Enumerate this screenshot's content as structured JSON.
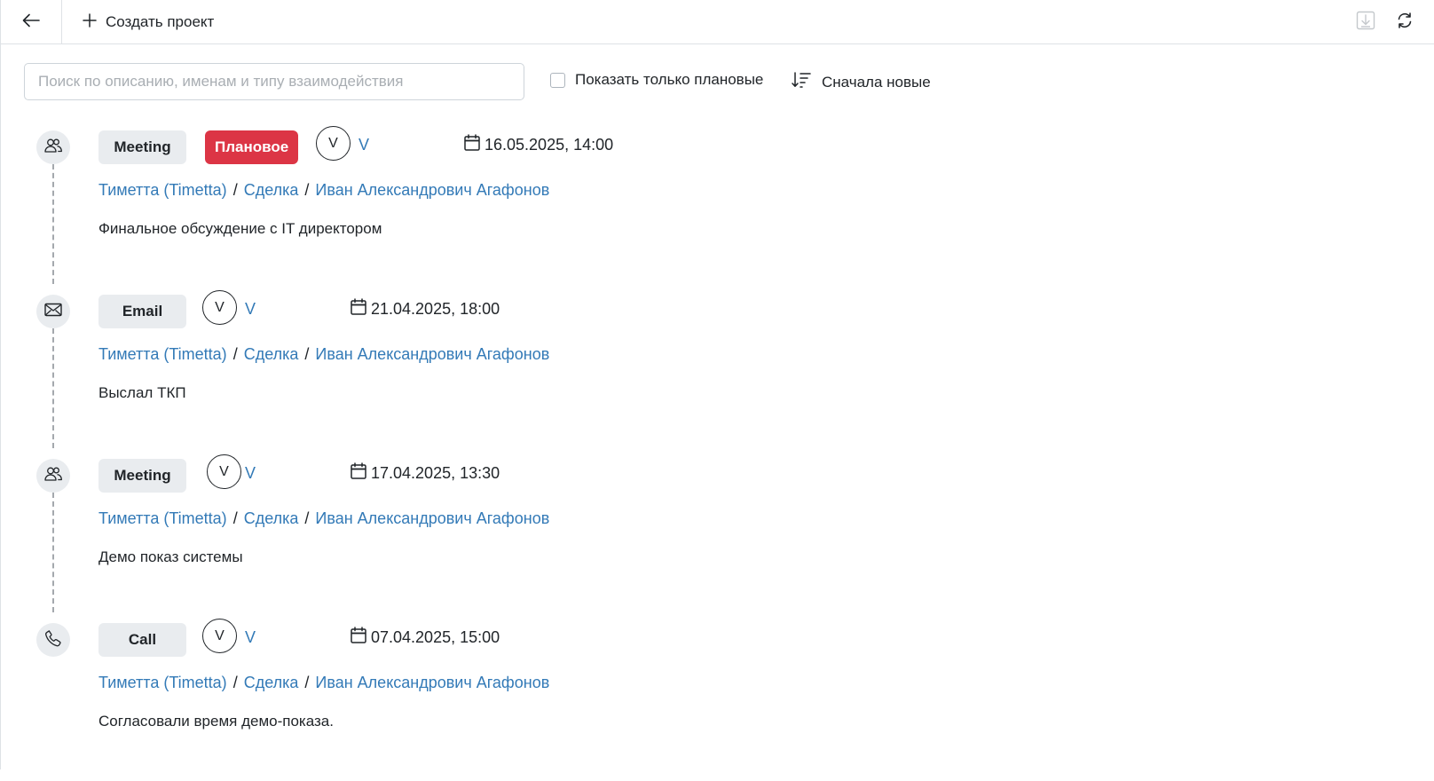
{
  "toolbar": {
    "back_icon": "arrow-left-icon",
    "create_label": "Создать проект",
    "right_icons": [
      "download-icon",
      "refresh-icon"
    ]
  },
  "filters": {
    "search_placeholder": "Поиск по описанию, именам и типу взаимодействия",
    "search_value": "",
    "planned_only_label": "Показать только плановые",
    "planned_only_checked": false,
    "sort_label": "Сначала новые"
  },
  "colors": {
    "link": "#337ab7",
    "planned": "#dc3545",
    "badge_bg": "#e9ecef"
  },
  "entries": [
    {
      "icon": "people-icon",
      "type": "Meeting",
      "planned_label": "Плановое",
      "avatar": "V",
      "author": "V",
      "date": "16.05.2025, 14:00",
      "company": "Тиметта (Timetta)",
      "deal": "Сделка",
      "contact": "Иван Александрович Агафонов",
      "description": "Финальное обсуждение с IT директором"
    },
    {
      "icon": "envelope-icon",
      "type": "Email",
      "avatar": "V",
      "author": "V",
      "date": "21.04.2025, 18:00",
      "company": "Тиметта (Timetta)",
      "deal": "Сделка",
      "contact": "Иван Александрович Агафонов",
      "description": "Выслал ТКП"
    },
    {
      "icon": "people-icon",
      "type": "Meeting",
      "avatar": "V",
      "author": "V",
      "date": "17.04.2025, 13:30",
      "company": "Тиметта (Timetta)",
      "deal": "Сделка",
      "contact": "Иван Александрович Агафонов",
      "description": "Демо показ системы"
    },
    {
      "icon": "phone-icon",
      "type": "Call",
      "avatar": "V",
      "author": "V",
      "date": "07.04.2025, 15:00",
      "company": "Тиметта (Timetta)",
      "deal": "Сделка",
      "contact": "Иван Александрович Агафонов",
      "description": "Согласовали время демо-показа."
    }
  ]
}
